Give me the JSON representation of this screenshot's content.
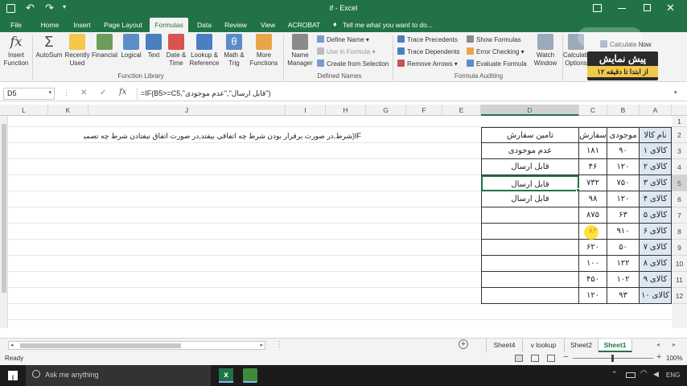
{
  "title": "if - Excel",
  "qat_icons": [
    "save-icon",
    "undo-icon",
    "redo-icon"
  ],
  "tabs": [
    "File",
    "Home",
    "Insert",
    "Page Layout",
    "Formulas",
    "Data",
    "Review",
    "View",
    "ACROBAT"
  ],
  "tell_me": "Tell me what you want to do...",
  "ribbon": {
    "insert_function": "Insert Function",
    "autosum": "AutoSum",
    "recently_used": "Recently Used",
    "financial": "Financial",
    "logical": "Logical",
    "text": "Text",
    "date_time": "Date & Time",
    "lookup": "Lookup & Reference",
    "math": "Math & Trig",
    "more": "More Functions",
    "function_library": "Function Library",
    "name_manager": "Name Manager",
    "define_name": "Define Name",
    "use_in_formula": "Use in Formula",
    "create_from_selection": "Create from Selection",
    "defined_names": "Defined Names",
    "trace_precedents": "Trace Precedents",
    "trace_dependents": "Trace Dependents",
    "remove_arrows": "Remove Arrows",
    "show_formulas": "Show Formulas",
    "error_checking": "Error Checking",
    "evaluate_formula": "Evaluate Formula",
    "formula_auditing": "Formula Auditing",
    "watch_window": "Watch Window",
    "calc_options": "Calculation Options",
    "calc_now": "Calculate Now"
  },
  "watermark": {
    "line1": "پیش نمایش",
    "line2": "از ابتدا تا دقیقه ۱۲"
  },
  "name_box": "D5",
  "formula": "=IF(B5>=C5,\"قابل ارسال\",\"عدم موجودی\")",
  "columns": [
    "L",
    "K",
    "J",
    "I",
    "H",
    "G",
    "F",
    "E",
    "D",
    "C",
    "B",
    "A"
  ],
  "rows": [
    "1",
    "2",
    "3",
    "4",
    "5",
    "6",
    "7",
    "8",
    "9",
    "10",
    "11",
    "12"
  ],
  "note": "IF(شرط,در صورت برقرار بودن شرط چه اتفاقی بیفتد,در صورت اتفاق نیفتادن شرط چه تصمیمی گرفته شود)",
  "table": {
    "headers": {
      "a": "نام کالا",
      "b": "موجودی",
      "c": "سفارش",
      "d": "تامین سفارش"
    },
    "rows": [
      {
        "a": "کالای ۱",
        "b": "۹۰",
        "c": "۱۸۱",
        "d": "عدم موجودی"
      },
      {
        "a": "کالای ۲",
        "b": "۱۲۰",
        "c": "۴۶",
        "d": "قابل ارسال"
      },
      {
        "a": "کالای ۳",
        "b": "۷۵۰",
        "c": "۷۳۲",
        "d": "قابل ارسال"
      },
      {
        "a": "کالای ۴",
        "b": "۱۲۰",
        "c": "۹۸",
        "d": "قابل ارسال"
      },
      {
        "a": "کالای ۵",
        "b": "۶۳",
        "c": "۸۷۵",
        "d": ""
      },
      {
        "a": "کالای ۶",
        "b": "۹۱۰",
        "c": "۸۲",
        "d": ""
      },
      {
        "a": "کالای ۷",
        "b": "۵۰",
        "c": "۶۲۰",
        "d": ""
      },
      {
        "a": "کالای ۸",
        "b": "۱۲۲",
        "c": "۱۰۰",
        "d": ""
      },
      {
        "a": "کالای ۹",
        "b": "۱۰۲",
        "c": "۴۵۰",
        "d": ""
      },
      {
        "a": "کالای ۱۰",
        "b": "۹۳",
        "c": "۱۲۰",
        "d": ""
      }
    ]
  },
  "sheets": [
    "Sheet4",
    "v lookup",
    "Sheet2",
    "Sheet1"
  ],
  "active_sheet": "Sheet1",
  "status": "Ready",
  "zoom": "100%",
  "taskbar": {
    "search": "Ask me anything",
    "lang": "ENG"
  }
}
